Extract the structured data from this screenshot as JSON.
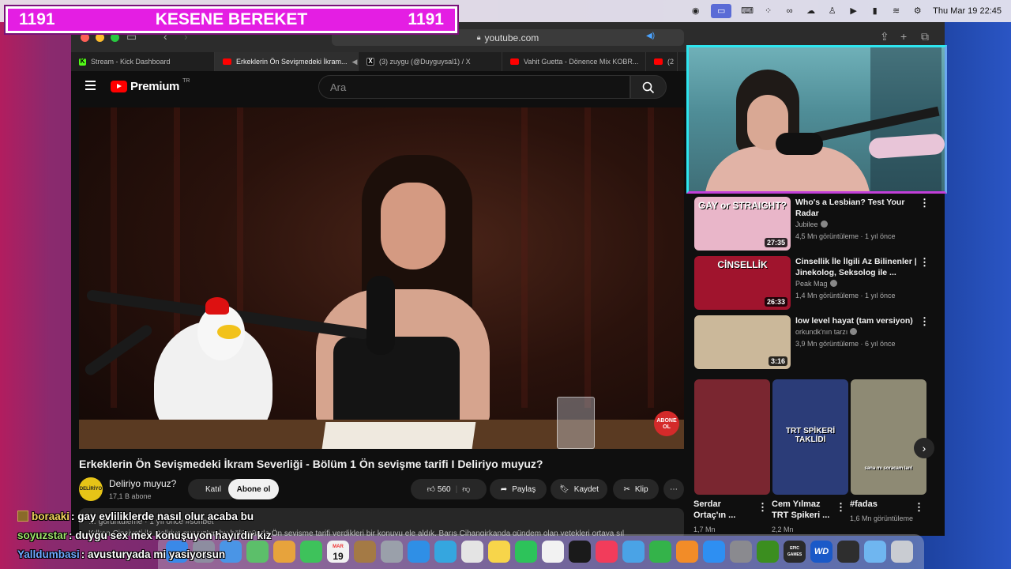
{
  "menubar": {
    "clock": "Thu Mar 19  22:45",
    "icons": [
      "chrome-icon",
      "screen-mirror-icon",
      "keyboard-icon",
      "grid-icon",
      "creative-cloud-icon",
      "cloud-icon",
      "stream-icon",
      "play-icon",
      "battery-icon",
      "wifi-icon",
      "control-center-icon"
    ]
  },
  "overlay": {
    "left_count": "1191",
    "title": "KESENE BEREKET",
    "right_count": "1191",
    "color": "#e41ee3"
  },
  "browser": {
    "url": "youtube.com",
    "tabs": [
      {
        "label": "Stream - Kick Dashboard",
        "icon": "kick"
      },
      {
        "label": "Erkeklerin Ön Sevişmedeki İkram...",
        "icon": "yt"
      },
      {
        "label": "(3) zuygu (@Duyguysal1) / X",
        "icon": "x"
      },
      {
        "label": "Vahit Guetta - Dönence Mix KOBR...",
        "icon": "yt"
      },
      {
        "label": "(2",
        "icon": "yt"
      }
    ]
  },
  "youtube": {
    "logo": "Premium",
    "logo_region": "TR",
    "search_placeholder": "Ara",
    "video": {
      "title": "Erkeklerin Ön Sevişmedeki İkram Severliği - Bölüm 1 Ön sevişme tarifi I Deliriyo muyuz?",
      "subscribe_badge": "ABONE OL",
      "channel": "Deliriyo muyuz?",
      "avatar_text": "DELİRİYO MUYUZ?",
      "subscribers": "17,1 B abone",
      "join_label": "Katıl",
      "subscribe_label": "Abone ol",
      "likes": "560",
      "share_label": "Paylaş",
      "save_label": "Kaydet",
      "clip_label": "Klip",
      "desc_line1": "… görüntüleme · 1 yıl önce  #sohbet",
      "desc_line2": "Kılkan Cinsiyeti ile Deliriyo muyuz’un bu bölümünde Ön sevişme tarifi verdikleri bir konuyu ele aldık. Barış Cihangirkanda gündem olan yetekleri ortaya sıl"
    },
    "recommendations": [
      {
        "title": "Who's a Lesbian? Test Your Radar",
        "channel": "Jubilee",
        "meta": "4,5 Mn görüntüleme · 1 yıl önce",
        "duration": "27:35",
        "thumb_text": "GAY or STRAIGHT?",
        "thumb_color": "#e9b6c9"
      },
      {
        "title": "Cinsellik İle İlgili Az Bilinenler | Jinekolog, Seksolog ile ...",
        "channel": "Peak Mag",
        "meta": "1,4 Mn görüntüleme · 1 yıl önce",
        "duration": "26:33",
        "thumb_text": "CİNSELLİK",
        "thumb_color": "#a0142d"
      },
      {
        "title": "low level hayat (tam versiyon)",
        "channel": "orkundk'nın tarzı",
        "meta": "3,9 Mn görüntüleme · 6 yıl önce",
        "duration": "3:16",
        "thumb_text": "",
        "thumb_color": "#cbb89a"
      }
    ],
    "shorts": [
      {
        "title": "Serdar Ortaç'ın ...",
        "meta": "1,7 Mn",
        "thumb_color": "#7a2630",
        "thumb_text": ""
      },
      {
        "title": "Cem Yılmaz TRT Spikeri ...",
        "meta": "2,2 Mn",
        "thumb_color": "#2b3c78",
        "thumb_text": "TRT SPİKERİ TAKLİDİ"
      },
      {
        "title": "#fadas",
        "meta": "1,6 Mn görüntüleme",
        "thumb_color": "#8e8a74",
        "thumb_text": "sana mı soracam lan!"
      }
    ]
  },
  "chat": [
    {
      "user": "boraaki",
      "user_color": "#f4d35e",
      "message": ": gay evliliklerde nasıl olur acaba bu",
      "badge": true
    },
    {
      "user": "soyuzstar",
      "user_color": "#9ee06a",
      "message": ": duygu sex mex konuşuyon hayırdır kız",
      "badge": false
    },
    {
      "user": "Yalldumbasi",
      "user_color": "#6fa8ff",
      "message": ": avusturyada mi yasiyorsun",
      "badge": false
    }
  ],
  "dock": {
    "calendar_month": "MAR",
    "calendar_day": "19",
    "wd_label": "WD",
    "epic_label": "EPIC GAMES",
    "apps": [
      {
        "name": "finder-app",
        "color": "#3a89e8"
      },
      {
        "name": "launchpad-app",
        "color": "#8d8da0"
      },
      {
        "name": "mail-app",
        "color": "#4a95e6"
      },
      {
        "name": "maps-app",
        "color": "#5cbf6a"
      },
      {
        "name": "photos-app",
        "color": "#e7a33c"
      },
      {
        "name": "messages-app",
        "color": "#3ec25b"
      },
      {
        "name": "calendar-app",
        "color": "#f2f2f2"
      },
      {
        "name": "notes-folder-app",
        "color": "#a47a45"
      },
      {
        "name": "settings-panel-app",
        "color": "#9aa0aa"
      },
      {
        "name": "safari-app",
        "color": "#2f8fe6"
      },
      {
        "name": "telegram-app",
        "color": "#35a6df"
      },
      {
        "name": "chrome-app",
        "color": "#e4e4e4"
      },
      {
        "name": "notes-app",
        "color": "#f7d54a"
      },
      {
        "name": "whatsapp-app",
        "color": "#2dc35a"
      },
      {
        "name": "freeform-app",
        "color": "#f2f2f2"
      },
      {
        "name": "apple-tv-app",
        "color": "#1a1a1a"
      },
      {
        "name": "music-app",
        "color": "#f23c5b"
      },
      {
        "name": "preview-app",
        "color": "#4aa3e6"
      },
      {
        "name": "numbers-app",
        "color": "#34b34a"
      },
      {
        "name": "pages-app",
        "color": "#f28c28"
      },
      {
        "name": "app-store-app",
        "color": "#2e8ff2"
      },
      {
        "name": "system-settings-app",
        "color": "#8a8a8f"
      },
      {
        "name": "xbox-app",
        "color": "#3b8e1f"
      },
      {
        "name": "epic-games-app",
        "color": "#2a2a2a"
      },
      {
        "name": "wd-app",
        "color": "#1a59c8"
      },
      {
        "name": "obs-app",
        "color": "#2e2e2e"
      },
      {
        "name": "downloads-folder-app",
        "color": "#6fb6f0"
      },
      {
        "name": "trash-app",
        "color": "#c9ccd2"
      }
    ]
  }
}
